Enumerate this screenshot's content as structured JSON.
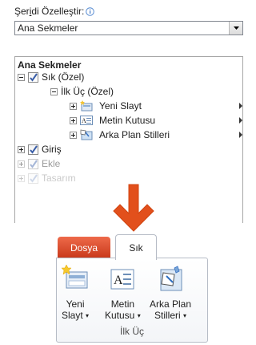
{
  "customize": {
    "label_prefix": "Şer",
    "label_underlined": "i",
    "label_suffix": "di Özelleştir:",
    "dropdown_value": "Ana Sekmeler"
  },
  "tree": {
    "header": "Ana Sekmeler",
    "tab_sik": "Sık (Özel)",
    "group_ilkuc": "İlk Üç (Özel)",
    "commands": [
      {
        "label": "Yeni Slayt",
        "icon": "new-slide-icon"
      },
      {
        "label": "Metin Kutusu",
        "icon": "text-box-icon"
      },
      {
        "label": "Arka Plan Stilleri",
        "icon": "background-styles-icon"
      }
    ],
    "tab_giris": "Giriş",
    "tab_ekle": "Ekle",
    "tab_tasarim": "Tasarım"
  },
  "ribbon": {
    "tab_file": "Dosya",
    "tab_sik": "Sık",
    "buttons": [
      {
        "line1": "Yeni",
        "line2": "Slayt"
      },
      {
        "line1": "Metin",
        "line2": "Kutusu"
      },
      {
        "line1": "Arka Plan",
        "line2": "Stilleri"
      }
    ],
    "group_label": "İlk Üç"
  },
  "colors": {
    "accent_arrow": "#e2501c",
    "file_tab": "#d8482a"
  }
}
